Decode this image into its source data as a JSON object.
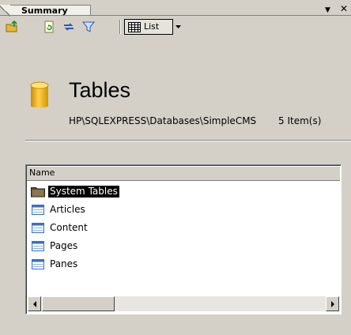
{
  "tab": {
    "label": "Summary"
  },
  "window_controls": {
    "dropdown_icon": "chevron-down-icon",
    "close_icon": "close-icon",
    "close_glyph": "✕",
    "dropdown_glyph": "▼"
  },
  "toolbar": {
    "buttons": [
      {
        "name": "up-folder-icon"
      },
      {
        "name": "refresh-icon"
      },
      {
        "name": "sync-icon"
      },
      {
        "name": "filter-icon"
      }
    ],
    "view": {
      "label": "List",
      "icon": "list-view-icon"
    }
  },
  "header": {
    "icon": "database-icon",
    "title": "Tables",
    "path": "HP\\SQLEXPRESS\\Databases\\SimpleCMS",
    "count": "5 Item(s)"
  },
  "list": {
    "column_header": "Name",
    "items": [
      {
        "label": "System Tables",
        "icon": "folder-icon",
        "selected": true
      },
      {
        "label": "Articles",
        "icon": "table-icon",
        "selected": false
      },
      {
        "label": "Content",
        "icon": "table-icon",
        "selected": false
      },
      {
        "label": "Pages",
        "icon": "table-icon",
        "selected": false
      },
      {
        "label": "Panes",
        "icon": "table-icon",
        "selected": false
      }
    ]
  },
  "colors": {
    "background": "#d4d0c8",
    "selection": "#000000",
    "db_icon": "#f2b600"
  }
}
